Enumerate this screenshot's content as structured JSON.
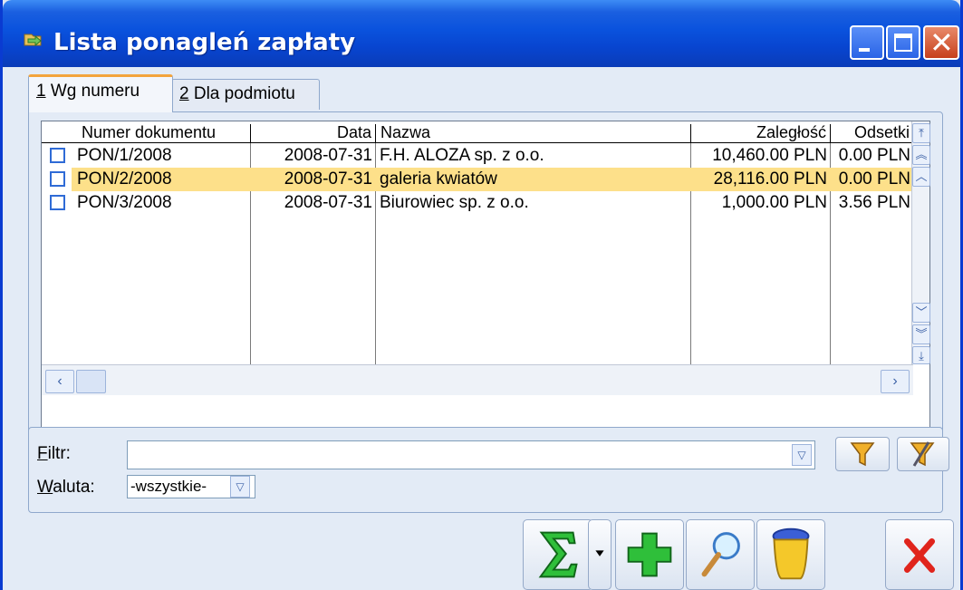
{
  "window": {
    "title": "Lista ponagleń zapłaty"
  },
  "tabs": [
    {
      "number": "1",
      "label": " Wg numeru"
    },
    {
      "number": "2",
      "label": " Dla podmiotu"
    }
  ],
  "grid": {
    "columns": [
      "Numer dokumentu",
      "Data",
      "Nazwa",
      "Zaległość",
      "Odsetki"
    ],
    "rows": [
      {
        "numer": "PON/1/2008",
        "data": "2008-07-31",
        "nazwa": "F.H. ALOZA sp. z o.o.",
        "zaleglosc": "10,460.00 PLN",
        "odsetki": "0.00 PLN",
        "selected": false
      },
      {
        "numer": "PON/2/2008",
        "data": "2008-07-31",
        "nazwa": "galeria kwiatów",
        "zaleglosc": "28,116.00 PLN",
        "odsetki": "0.00 PLN",
        "selected": true
      },
      {
        "numer": "PON/3/2008",
        "data": "2008-07-31",
        "nazwa": "Biurowiec sp. z o.o.",
        "zaleglosc": "1,000.00 PLN",
        "odsetki": "3.56 PLN",
        "selected": false
      }
    ]
  },
  "filter": {
    "filtr_label_accel": "F",
    "filtr_label_rest": "iltr:",
    "filtr_value": "",
    "waluta_label_accel": "W",
    "waluta_label_rest": "aluta:",
    "waluta_value": "-wszystkie-"
  },
  "icons": {
    "app": "folder-arrow-icon",
    "funnel": "funnel-icon",
    "clear_filter": "clear-filter-icon",
    "sum": "sigma-icon",
    "add": "plus-icon",
    "preview": "magnifier-icon",
    "delete": "trash-bin-icon",
    "close": "red-x-icon"
  },
  "colors": {
    "titlebar": "#0a52dd",
    "selected_row": "#fde08a",
    "active_tab_accent": "#f3a43c"
  }
}
